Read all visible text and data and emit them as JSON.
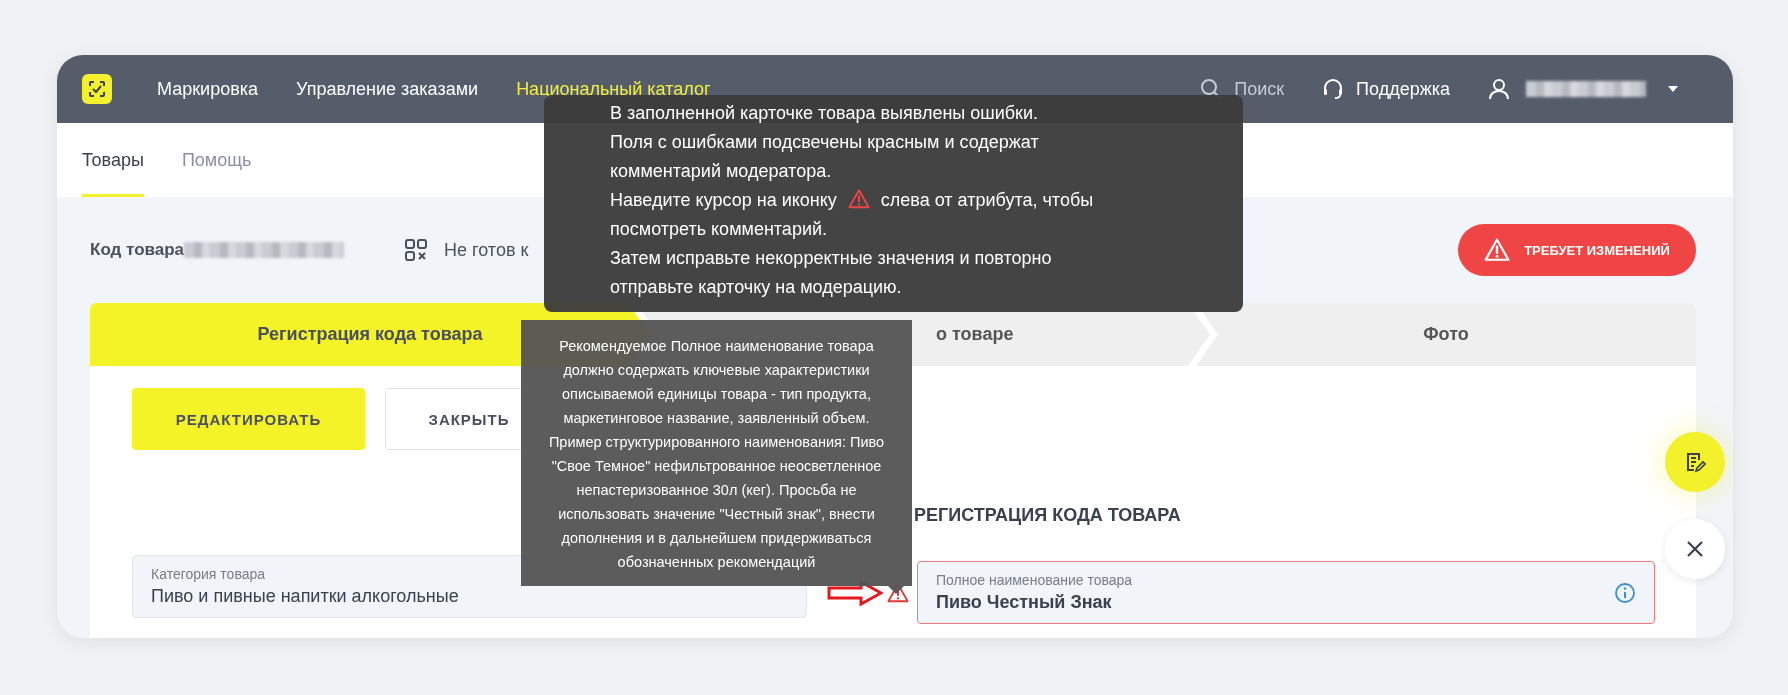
{
  "navbar": {
    "items": [
      {
        "label": "Маркировка",
        "selected": false
      },
      {
        "label": "Управление заказами",
        "selected": false
      },
      {
        "label": "Национальный каталог",
        "selected": true
      }
    ],
    "search": {
      "label": "Поиск"
    },
    "support": {
      "label": "Поддержка"
    }
  },
  "subnav": {
    "tabs": [
      {
        "label": "Товары",
        "selected": true
      },
      {
        "label": "Помощь",
        "selected": false
      }
    ]
  },
  "product": {
    "code_label": "Код товара",
    "status": "Не готов к",
    "badge": "ТРЕБУЕТ ИЗМЕНЕНИЙ"
  },
  "steps": [
    {
      "label": "Регистрация кода товара",
      "selected": true
    },
    {
      "label": "о товаре",
      "selected": false
    },
    {
      "label": "Фото",
      "selected": false
    }
  ],
  "actions": [
    {
      "label": "РЕДАКТИРОВАТЬ",
      "kind": "primary"
    },
    {
      "label": "ЗАКРЫТЬ",
      "kind": "secondary"
    }
  ],
  "section_title": "РЕГИСТРАЦИЯ КОДА ТОВАРА",
  "fields": [
    {
      "label": "Категория товара",
      "value": "Пиво и пивные напитки алкогольные",
      "error": false
    },
    {
      "label": "Полное наименование товара",
      "value": "Пиво Честный Знак",
      "error": true
    }
  ],
  "notice_tooltip": {
    "paragraphs": [
      {
        "text": "В заполненной карточке товара выявлены ошибки."
      },
      {
        "text": "Поля с ошибками подсвечены красным и содержат комментарий модератора."
      },
      {
        "text": "Наведите курсор на иконку",
        "after_icon": "слева от атрибута, чтобы"
      },
      {
        "text": "посмотреть комментарий."
      },
      {
        "text": "Затем исправьте некорректные значения и повторно отправьте карточку на модерацию."
      }
    ]
  },
  "comment_tooltip": {
    "text": "Рекомендуемое Полное наименование товара должно содержать ключевые характеристики описываемой единицы товара - тип продукта, маркетинговое название, заявленный объем. Пример структурированного наименования: Пиво \"Свое Темное\" нефильтрованное неосветленное непастеризованное 30л (кег). Просьба не использовать значение \"Честный знак\", внести дополнения и в дальнейшем придерживаться обозначенных рекомендаций"
  }
}
